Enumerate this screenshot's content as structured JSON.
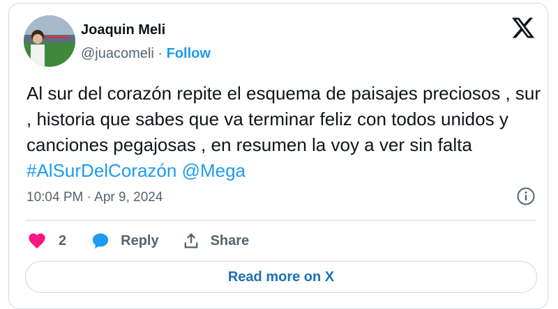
{
  "author": {
    "name": "Joaquin Meli",
    "handle": "@juacomeli",
    "separator": "·",
    "follow_label": "Follow"
  },
  "tweet": {
    "text_plain": "Al sur del corazón repite el esquema de paisajes preciosos , sur , historia que sabes que va terminar feliz con todos unidos y canciones pegajosas , en resumen la voy a ver sin falta ",
    "hashtag": "#AlSurDelCorazón",
    "mention": "@Mega",
    "timestamp": "10:04 PM · Apr 9, 2024"
  },
  "actions": {
    "like_count": "2",
    "reply_label": "Reply",
    "share_label": "Share"
  },
  "read_more_label": "Read more on X",
  "icons": {
    "logo": "x-logo-icon",
    "info": "info-icon",
    "like": "heart-icon",
    "reply": "reply-bubble-icon",
    "share": "share-icon"
  },
  "colors": {
    "link": "#1d9bf0",
    "like": "#f91880",
    "muted": "#536471",
    "border": "#cfd9de"
  }
}
